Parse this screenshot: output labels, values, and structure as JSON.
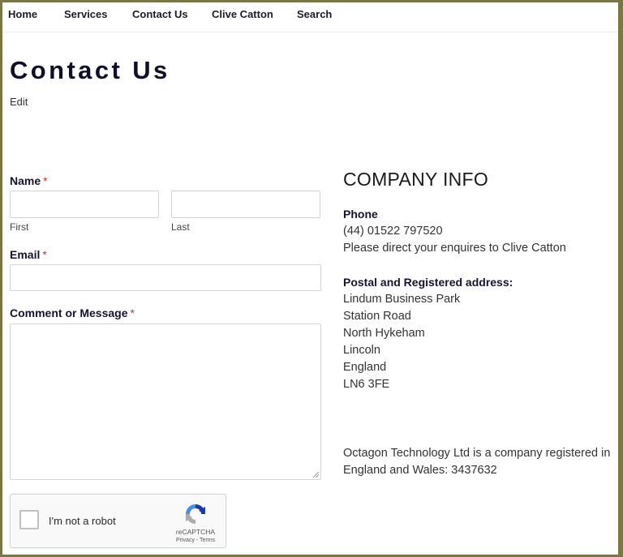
{
  "nav": {
    "items": [
      "Home",
      "Services",
      "Contact Us",
      "Clive Catton",
      "Search"
    ]
  },
  "page": {
    "title": "Contact Us",
    "edit_label": "Edit"
  },
  "form": {
    "name": {
      "label": "Name",
      "required_mark": "*",
      "first": {
        "value": "",
        "sublabel": "First"
      },
      "last": {
        "value": "",
        "sublabel": "Last"
      }
    },
    "email": {
      "label": "Email",
      "required_mark": "*",
      "value": ""
    },
    "message": {
      "label": "Comment or Message",
      "required_mark": "*",
      "value": ""
    },
    "captcha": {
      "label": "I'm not a robot",
      "brand": "reCAPTCHA",
      "links": "Privacy - Terms",
      "checked": false
    }
  },
  "company": {
    "heading": "COMPANY INFO",
    "phone_label": "Phone",
    "phone": "(44) 01522 797520",
    "phone_note": "Please direct your enquires to Clive Catton",
    "address_label": "Postal and Registered address:",
    "address": [
      "Lindum Business Park",
      "Station Road",
      "North Hykeham",
      "Lincoln",
      "England",
      "LN6 3FE"
    ],
    "registration": [
      "Octagon Technology Ltd is a company registered in",
      "England and Wales: 3437632"
    ]
  },
  "colors": {
    "frame_border": "#7b7645",
    "heading": "#0f0f2a",
    "required": "#c0392b"
  }
}
